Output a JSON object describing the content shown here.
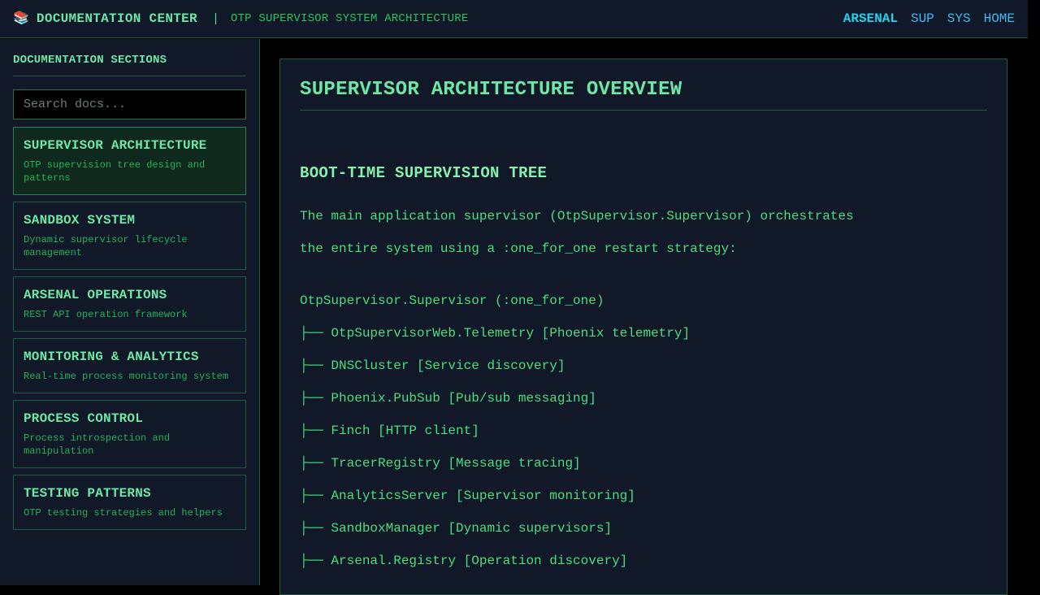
{
  "header": {
    "icon": "books-icon",
    "title": "DOCUMENTATION CENTER",
    "separator": "|",
    "subtitle": "OTP SUPERVISOR SYSTEM ARCHITECTURE",
    "nav": [
      {
        "label": "ARSENAL",
        "active": true
      },
      {
        "label": "SUP",
        "active": false
      },
      {
        "label": "SYS",
        "active": false
      },
      {
        "label": "HOME",
        "active": false
      }
    ]
  },
  "sidebar": {
    "heading": "DOCUMENTATION SECTIONS",
    "search_placeholder": "Search docs...",
    "items": [
      {
        "title": "SUPERVISOR ARCHITECTURE",
        "desc": "OTP supervision tree design and patterns",
        "active": true
      },
      {
        "title": "SANDBOX SYSTEM",
        "desc": "Dynamic supervisor lifecycle management",
        "active": false
      },
      {
        "title": "ARSENAL OPERATIONS",
        "desc": "REST API operation framework",
        "active": false
      },
      {
        "title": "MONITORING & ANALYTICS",
        "desc": "Real-time process monitoring system",
        "active": false
      },
      {
        "title": "PROCESS CONTROL",
        "desc": "Process introspection and manipulation",
        "active": false
      },
      {
        "title": "TESTING PATTERNS",
        "desc": "OTP testing strategies and helpers",
        "active": false
      }
    ]
  },
  "main": {
    "title": "SUPERVISOR ARCHITECTURE OVERVIEW",
    "section_title": "BOOT-TIME SUPERVISION TREE",
    "paragraph": [
      "The main application supervisor (OtpSupervisor.Supervisor) orchestrates",
      "the entire system using a :one_for_one restart strategy:"
    ],
    "tree": [
      "OtpSupervisor.Supervisor (:one_for_one)",
      "├── OtpSupervisorWeb.Telemetry [Phoenix telemetry]",
      "├── DNSCluster [Service discovery]",
      "├── Phoenix.PubSub [Pub/sub messaging]",
      "├── Finch [HTTP client]",
      "├── TracerRegistry [Message tracing]",
      "├── AnalyticsServer [Supervisor monitoring]",
      "├── SandboxManager [Dynamic supervisors]",
      "├── Arsenal.Registry [Operation discovery]"
    ]
  }
}
